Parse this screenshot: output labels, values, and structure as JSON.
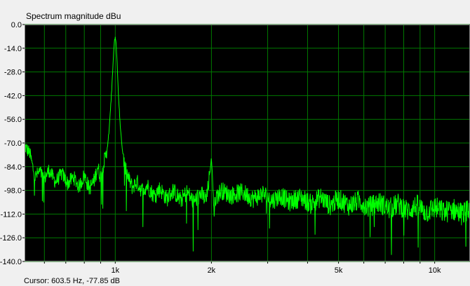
{
  "window": {
    "title": "Spectrum magnitude dBu",
    "cursor_readout": "Cursor:  603.5 Hz, -77.85 dB"
  },
  "colors": {
    "plot_background": "#000000",
    "grid": "#007a00",
    "trace": "#00ff00",
    "window_background": "#f0f0f0"
  },
  "chart_data": {
    "type": "line",
    "title": "Spectrum magnitude dBu",
    "xlabel": "",
    "ylabel": "",
    "x_scale": "log",
    "xlim": [
      520,
      12900
    ],
    "ylim": [
      -140,
      0
    ],
    "y_tick_values": [
      0,
      -14,
      -28,
      -42,
      -56,
      -70,
      -84,
      -98,
      -112,
      -126,
      -140
    ],
    "y_tick_labels": [
      "0.0",
      "-14.0",
      "-28.0",
      "-42.0",
      "-56.0",
      "-70.0",
      "-84.0",
      "-98.0",
      "-112.0",
      "-126.0",
      "-140.0"
    ],
    "x_tick_values": [
      1000,
      2000,
      5000,
      10000
    ],
    "x_tick_labels": [
      "1k",
      "2k",
      "5k",
      "10k"
    ],
    "x_grid_values": [
      600,
      700,
      800,
      900,
      1000,
      2000,
      3000,
      4000,
      5000,
      6000,
      7000,
      8000,
      9000,
      10000
    ],
    "grid": true,
    "legend": "none",
    "series": [
      {
        "points": [
          [
            520,
            -72
          ],
          [
            540,
            -76
          ],
          [
            560,
            -90
          ],
          [
            580,
            -87
          ],
          [
            600,
            -91
          ],
          [
            620,
            -86
          ],
          [
            650,
            -93
          ],
          [
            680,
            -88
          ],
          [
            710,
            -94
          ],
          [
            740,
            -90
          ],
          [
            770,
            -96
          ],
          [
            800,
            -89
          ],
          [
            830,
            -97
          ],
          [
            860,
            -92
          ],
          [
            880,
            -84
          ],
          [
            900,
            -90
          ],
          [
            920,
            -82
          ],
          [
            940,
            -76
          ],
          [
            955,
            -64
          ],
          [
            965,
            -52
          ],
          [
            975,
            -38
          ],
          [
            985,
            -22
          ],
          [
            993,
            -10
          ],
          [
            1000,
            -8
          ],
          [
            1007,
            -12
          ],
          [
            1015,
            -26
          ],
          [
            1025,
            -44
          ],
          [
            1035,
            -58
          ],
          [
            1050,
            -72
          ],
          [
            1070,
            -84
          ],
          [
            1100,
            -91
          ],
          [
            1130,
            -96
          ],
          [
            1170,
            -93
          ],
          [
            1210,
            -98
          ],
          [
            1260,
            -95
          ],
          [
            1320,
            -101
          ],
          [
            1380,
            -97
          ],
          [
            1450,
            -103
          ],
          [
            1520,
            -98
          ],
          [
            1600,
            -104
          ],
          [
            1680,
            -99
          ],
          [
            1760,
            -105
          ],
          [
            1850,
            -100
          ],
          [
            1930,
            -104
          ],
          [
            1970,
            -90
          ],
          [
            1990,
            -84
          ],
          [
            2000,
            -78
          ],
          [
            2010,
            -86
          ],
          [
            2040,
            -112
          ],
          [
            2060,
            -102
          ],
          [
            2150,
            -98
          ],
          [
            2300,
            -101
          ],
          [
            2500,
            -99
          ],
          [
            2700,
            -103
          ],
          [
            2900,
            -100
          ],
          [
            3100,
            -104
          ],
          [
            3300,
            -101
          ],
          [
            3500,
            -105
          ],
          [
            3800,
            -102
          ],
          [
            4100,
            -106
          ],
          [
            4400,
            -102
          ],
          [
            4700,
            -107
          ],
          [
            5000,
            -103
          ],
          [
            5400,
            -107
          ],
          [
            5800,
            -104
          ],
          [
            6200,
            -108
          ],
          [
            6700,
            -105
          ],
          [
            7200,
            -109
          ],
          [
            7700,
            -106
          ],
          [
            8200,
            -110
          ],
          [
            8800,
            -107
          ],
          [
            9400,
            -111
          ],
          [
            10000,
            -108
          ],
          [
            10700,
            -111
          ],
          [
            11400,
            -109
          ],
          [
            12200,
            -112
          ],
          [
            12900,
            -110
          ]
        ],
        "noise_band_db": 7
      }
    ]
  }
}
